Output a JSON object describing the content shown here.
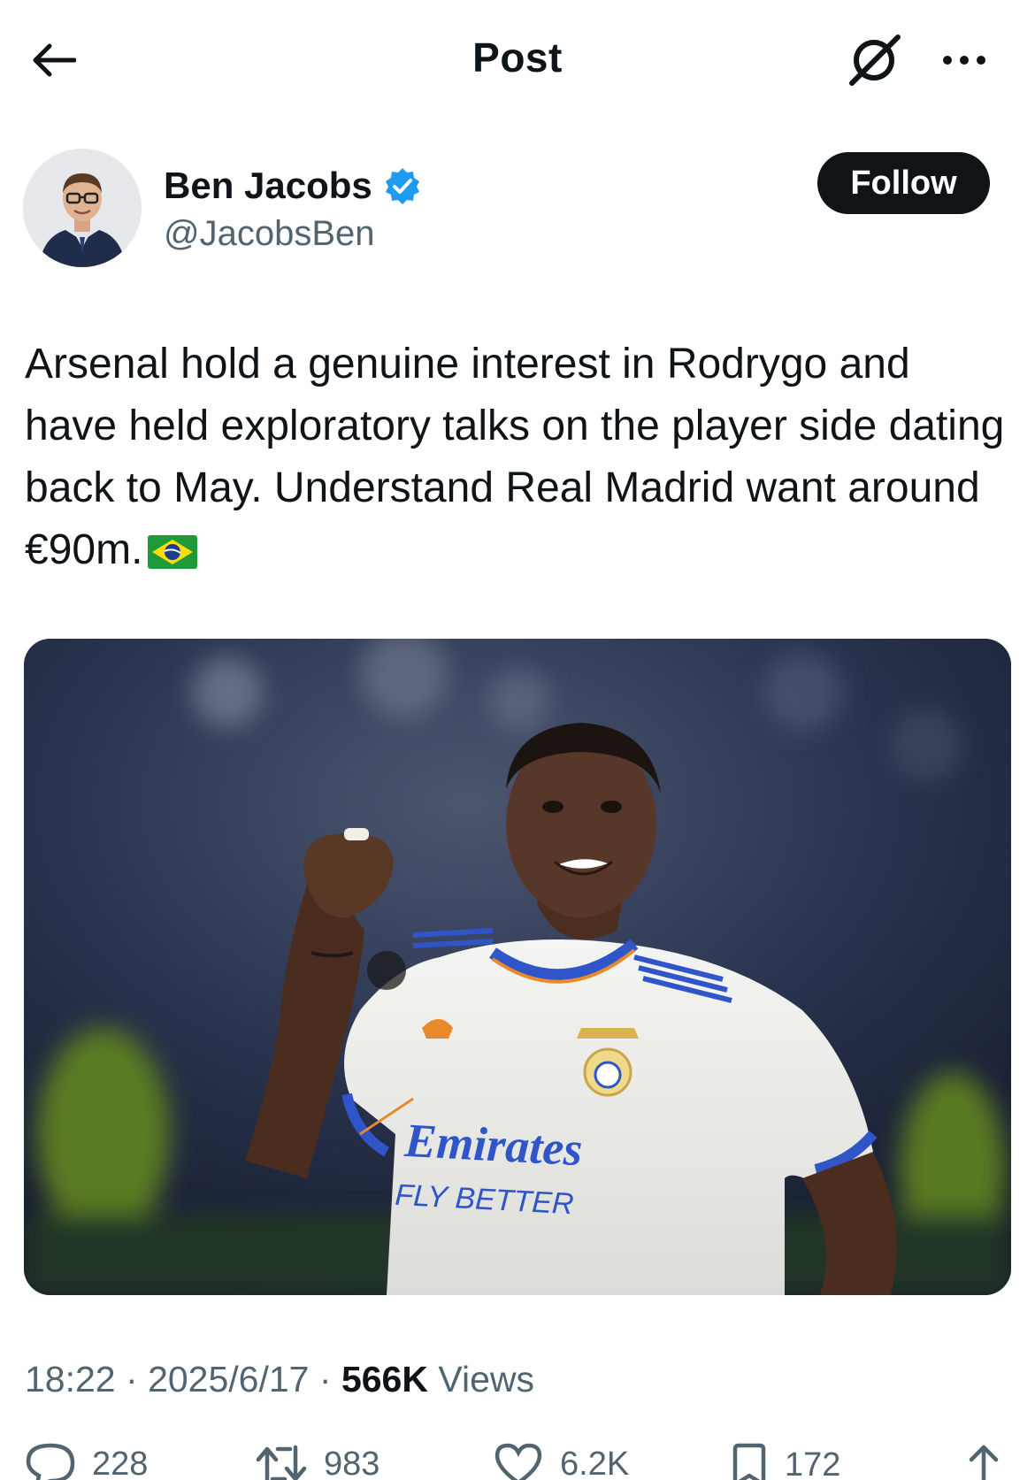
{
  "header": {
    "title": "Post"
  },
  "author": {
    "name": "Ben Jacobs",
    "handle": "@JacobsBen",
    "verified": true,
    "follow_label": "Follow"
  },
  "post": {
    "text": "Arsenal hold a genuine interest in Rodrygo and have held exploratory talks on the player side dating back to May. Understand Real Madrid want around €90m.",
    "flag_emoji": "brazil-flag",
    "media": {
      "jersey_line1": "Emirates",
      "jersey_line2": "FLY BETTER",
      "brand": "adidas"
    }
  },
  "meta": {
    "time": "18:22",
    "date": "2025/6/17",
    "views_count": "566K",
    "views_label": "Views",
    "sep": "·"
  },
  "actions": {
    "replies": "228",
    "reposts": "983",
    "likes": "6.2K",
    "bookmarks": "172"
  },
  "colors": {
    "text": "#0f1419",
    "secondary": "#536471",
    "verified": "#1d9bf0",
    "button": "#0f1419"
  }
}
